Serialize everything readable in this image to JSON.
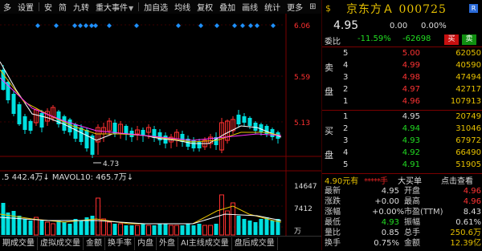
{
  "toolbar": {
    "items": [
      "多",
      "设置",
      "安",
      "简",
      "九转",
      "重大事件",
      "加自选",
      "均线",
      "复权",
      "叠加",
      "画线",
      "统计",
      "更多"
    ],
    "more_arrow": "▼"
  },
  "chart": {
    "price_ticks": [
      "6.06",
      "5.59",
      "5.13"
    ],
    "low_label": "4.73",
    "vol_info": ".5  442.4万↓  MAVOL10: 465.7万↓",
    "vol_ticks": [
      "14647",
      "7412",
      "万"
    ],
    "colors": {
      "up": "#ff3030",
      "down": "#00e0e0",
      "ma1": "#ffffff",
      "ma2": "#e6c000",
      "ma3": "#ff33ff",
      "marker": "#1e90ff"
    }
  },
  "tabs": [
    "期成交量",
    "虚拟成交量",
    "金额",
    "换手率",
    "内盘",
    "外盘",
    "AI主线成交量",
    "盘后成交量"
  ],
  "panel": {
    "title": "京东方Ａ 000725",
    "badge": "R",
    "last_price": "4.95",
    "change": "0.00",
    "change_pct": "0.00%",
    "ratio_label": "委比",
    "ratio_value": "-11.59%",
    "ratio_diff": "-62698",
    "buy_btn": "买",
    "sell_btn": "卖",
    "sell_side_label": [
      "卖",
      "盘"
    ],
    "buy_side_label": [
      "买",
      "盘"
    ],
    "asks": [
      {
        "level": "5",
        "price": "5.00",
        "qty": "62050"
      },
      {
        "level": "4",
        "price": "4.99",
        "qty": "40590"
      },
      {
        "level": "3",
        "price": "4.98",
        "qty": "47494"
      },
      {
        "level": "2",
        "price": "4.97",
        "qty": "42717"
      },
      {
        "level": "1",
        "price": "4.96",
        "qty": "107913"
      }
    ],
    "bids": [
      {
        "level": "1",
        "price": "4.95",
        "qty": "20749"
      },
      {
        "level": "2",
        "price": "4.94",
        "qty": "31046"
      },
      {
        "level": "3",
        "price": "4.93",
        "qty": "67972"
      },
      {
        "level": "4",
        "price": "4.92",
        "qty": "66490"
      },
      {
        "level": "5",
        "price": "4.91",
        "qty": "51905"
      }
    ],
    "strip": {
      "price": "4.90元有",
      "stars": "*****手",
      "label": "大买单",
      "link": "点击查看"
    },
    "stats": [
      {
        "l1": "最新",
        "v1": "4.95",
        "c1": "white",
        "l2": "开盘",
        "v2": "4.96",
        "c2": "red"
      },
      {
        "l1": "涨跌",
        "v1": "+0.00",
        "c1": "white",
        "l2": "最高",
        "v2": "4.96",
        "c2": "red"
      },
      {
        "l1": "涨幅",
        "v1": "+0.00%",
        "c1": "white",
        "l2": "市盈(TTM)",
        "v2": "8.43",
        "c2": "white"
      },
      {
        "l1": "最低",
        "v1": "4.93",
        "c1": "green",
        "l2": "振幅",
        "v2": "0.61%",
        "c2": "white"
      },
      {
        "l1": "量比",
        "v1": "0.85",
        "c1": "white",
        "l2": "总手",
        "v2": "250.6万",
        "c2": "yellow"
      },
      {
        "l1": "换手",
        "v1": "0.75%",
        "c1": "white",
        "l2": "金额",
        "v2": "12.39亿",
        "c2": "yellow"
      }
    ]
  }
}
